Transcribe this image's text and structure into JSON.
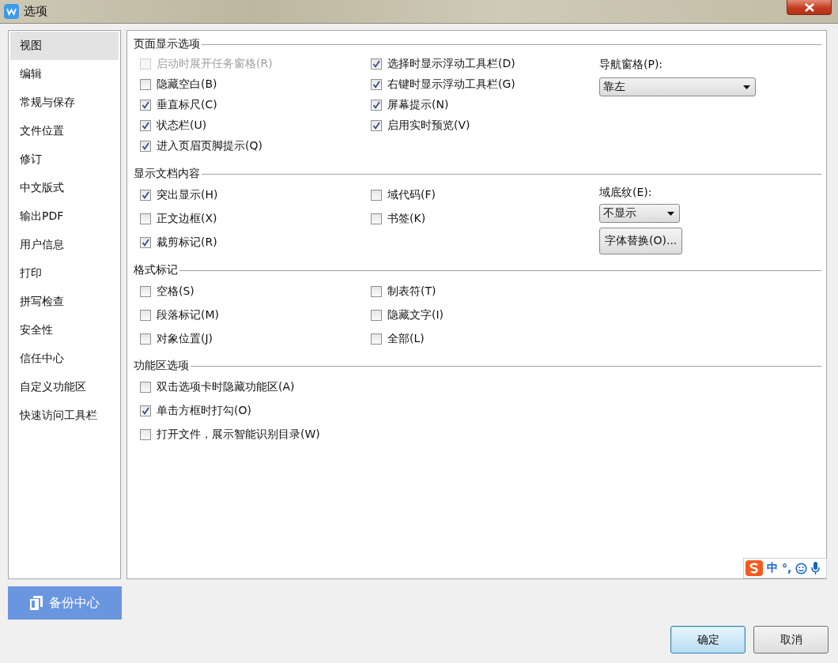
{
  "window": {
    "title": "选项"
  },
  "sidebar": {
    "items": [
      {
        "label": "视图",
        "selected": true
      },
      {
        "label": "编辑",
        "selected": false
      },
      {
        "label": "常规与保存",
        "selected": false
      },
      {
        "label": "文件位置",
        "selected": false
      },
      {
        "label": "修订",
        "selected": false
      },
      {
        "label": "中文版式",
        "selected": false
      },
      {
        "label": "输出PDF",
        "selected": false
      },
      {
        "label": "用户信息",
        "selected": false
      },
      {
        "label": "打印",
        "selected": false
      },
      {
        "label": "拼写检查",
        "selected": false
      },
      {
        "label": "安全性",
        "selected": false
      },
      {
        "label": "信任中心",
        "selected": false
      },
      {
        "label": "自定义功能区",
        "selected": false
      },
      {
        "label": "快速访问工具栏",
        "selected": false
      }
    ]
  },
  "sections": [
    {
      "title": "页面显示选项",
      "left": [
        {
          "label": "启动时展开任务窗格(R)",
          "checked": false,
          "disabled": true
        },
        {
          "label": "隐藏空白(B)",
          "checked": false,
          "disabled": false
        },
        {
          "label": "垂直标尺(C)",
          "checked": true,
          "disabled": false
        },
        {
          "label": "状态栏(U)",
          "checked": true,
          "disabled": false
        },
        {
          "label": "进入页眉页脚提示(Q)",
          "checked": true,
          "disabled": false
        }
      ],
      "middle": [
        {
          "label": "选择时显示浮动工具栏(D)",
          "checked": true,
          "disabled": false
        },
        {
          "label": "右键时显示浮动工具栏(G)",
          "checked": true,
          "disabled": false
        },
        {
          "label": "屏幕提示(N)",
          "checked": true,
          "disabled": false
        },
        {
          "label": "启用实时预览(V)",
          "checked": true,
          "disabled": false
        }
      ],
      "right": [
        {
          "kind": "label",
          "text": "导航窗格(P):"
        },
        {
          "kind": "dropdown",
          "value": "靠左"
        }
      ]
    },
    {
      "title": "显示文档内容",
      "left": [
        {
          "label": "突出显示(H)",
          "checked": true,
          "disabled": false
        },
        {
          "label": "正文边框(X)",
          "checked": false,
          "disabled": false
        },
        {
          "label": "裁剪标记(R)",
          "checked": true,
          "disabled": false
        }
      ],
      "middle": [
        {
          "label": "域代码(F)",
          "checked": false,
          "disabled": false
        },
        {
          "label": "书签(K)",
          "checked": false,
          "disabled": false
        }
      ],
      "right": [
        {
          "kind": "label",
          "text": "域底纹(E):"
        },
        {
          "kind": "dropdown",
          "value": "不显示"
        },
        {
          "kind": "button",
          "text": "字体替换(O)..."
        }
      ]
    },
    {
      "title": "格式标记",
      "left": [
        {
          "label": "空格(S)",
          "checked": false,
          "disabled": false
        },
        {
          "label": "段落标记(M)",
          "checked": false,
          "disabled": false
        },
        {
          "label": "对象位置(J)",
          "checked": false,
          "disabled": false
        }
      ],
      "middle": [
        {
          "label": "制表符(T)",
          "checked": false,
          "disabled": false
        },
        {
          "label": "隐藏文字(I)",
          "checked": false,
          "disabled": false
        },
        {
          "label": "全部(L)",
          "checked": false,
          "disabled": false
        }
      ]
    },
    {
      "title": "功能区选项",
      "left": [
        {
          "label": "双击选项卡时隐藏功能区(A)",
          "checked": false,
          "disabled": false
        },
        {
          "label": "单击方框时打勾(O)",
          "checked": true,
          "disabled": false
        },
        {
          "label": "打开文件，展示智能识别目录(W)",
          "checked": false,
          "disabled": false
        }
      ]
    }
  ],
  "backup_button": "备份中心",
  "buttons": [
    {
      "label": "确定",
      "default": true
    },
    {
      "label": "取消",
      "default": false
    }
  ],
  "ime_bar": {
    "mode": "中",
    "punctuation": "°,"
  }
}
